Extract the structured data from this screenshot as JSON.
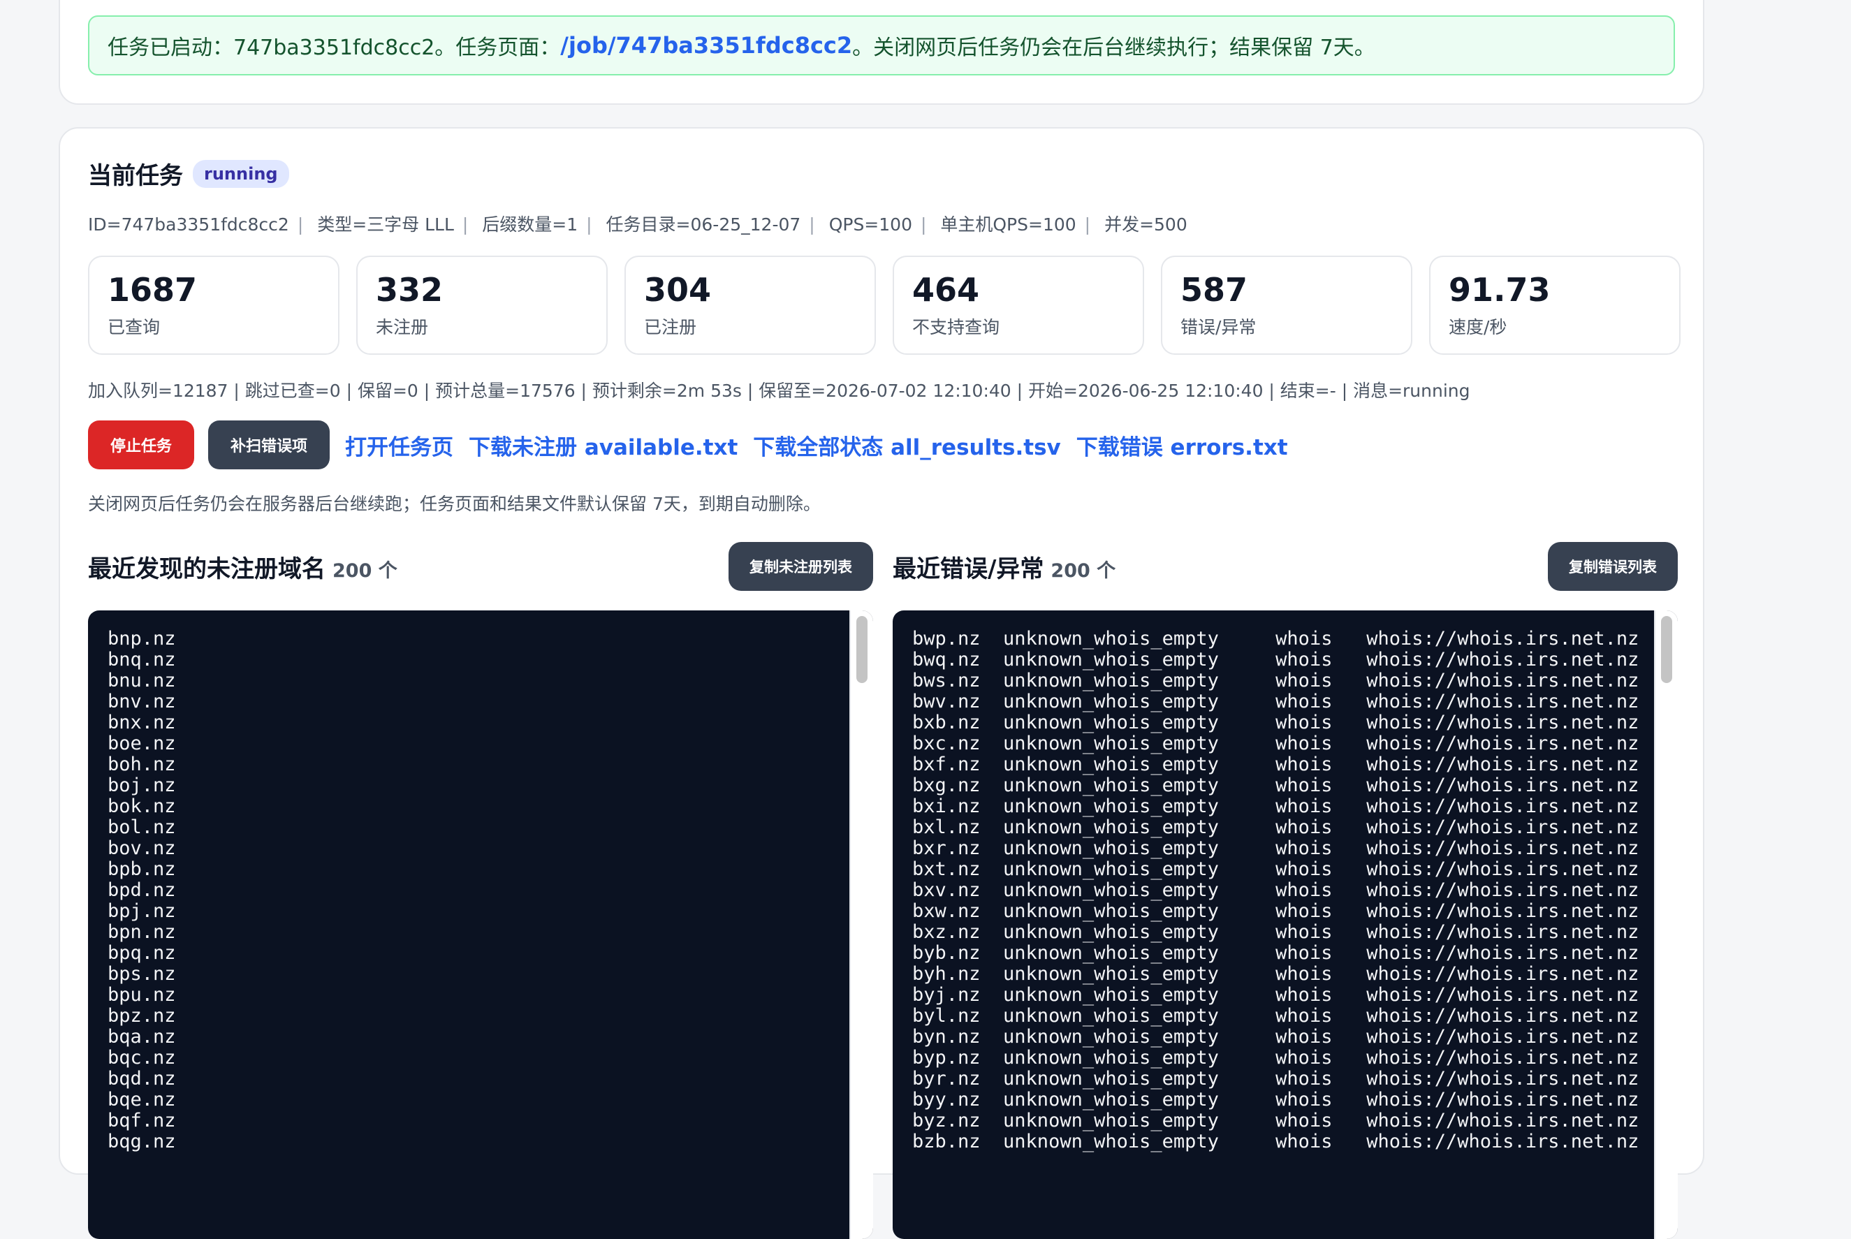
{
  "banner": {
    "prefix": "任务已启动：747ba3351fdc8cc2。任务页面：",
    "link": "/job/747ba3351fdc8cc2",
    "suffix": "。关闭网页后任务仍会在后台继续执行；结果保留 7天。"
  },
  "task": {
    "title": "当前任务",
    "status": "running",
    "meta": [
      "ID=747ba3351fdc8cc2",
      "类型=三字母 LLL",
      "后缀数量=1",
      "任务目录=06-25_12-07",
      "QPS=100",
      "单主机QPS=100",
      "并发=500"
    ],
    "meta_separator": "|"
  },
  "stats": [
    {
      "value": "1687",
      "label": "已查询"
    },
    {
      "value": "332",
      "label": "未注册"
    },
    {
      "value": "304",
      "label": "已注册"
    },
    {
      "value": "464",
      "label": "不支持查询"
    },
    {
      "value": "587",
      "label": "错误/异常"
    },
    {
      "value": "91.73",
      "label": "速度/秒"
    }
  ],
  "progress_text": "加入队列=12187 | 跳过已查=0 | 保留=0 | 预计总量=17576 | 预计剩余=2m 53s | 保留至=2026-07-02 12:10:40 | 开始=2026-06-25 12:10:40 | 结束=- | 消息=running",
  "actions": {
    "stop": "停止任务",
    "rescan": "补扫错误项",
    "open_page": "打开任务页",
    "dl_available": "下载未注册 available.txt",
    "dl_all": "下载全部状态 all_results.tsv",
    "dl_errors": "下载错误 errors.txt"
  },
  "note": "关闭网页后任务仍会在服务器后台继续跑；任务页面和结果文件默认保留 7天，到期自动删除。",
  "available_panel": {
    "title": "最近发现的未注册域名",
    "count": "200 个",
    "copy_label": "复制未注册列表",
    "lines": [
      "bnp.nz",
      "bnq.nz",
      "bnu.nz",
      "bnv.nz",
      "bnx.nz",
      "boe.nz",
      "boh.nz",
      "boj.nz",
      "bok.nz",
      "bol.nz",
      "bov.nz",
      "bpb.nz",
      "bpd.nz",
      "bpj.nz",
      "bpn.nz",
      "bpq.nz",
      "bps.nz",
      "bpu.nz",
      "bpz.nz",
      "bqa.nz",
      "bqc.nz",
      "bqd.nz",
      "bqe.nz",
      "bqf.nz",
      "bqg.nz"
    ]
  },
  "error_panel": {
    "title": "最近错误/异常",
    "count": "200 个",
    "copy_label": "复制错误列表",
    "lines": [
      "bwp.nz  unknown_whois_empty     whois   whois://whois.irs.net.nz",
      "bwq.nz  unknown_whois_empty     whois   whois://whois.irs.net.nz",
      "bws.nz  unknown_whois_empty     whois   whois://whois.irs.net.nz",
      "bwv.nz  unknown_whois_empty     whois   whois://whois.irs.net.nz",
      "bxb.nz  unknown_whois_empty     whois   whois://whois.irs.net.nz",
      "bxc.nz  unknown_whois_empty     whois   whois://whois.irs.net.nz",
      "bxf.nz  unknown_whois_empty     whois   whois://whois.irs.net.nz",
      "bxg.nz  unknown_whois_empty     whois   whois://whois.irs.net.nz",
      "bxi.nz  unknown_whois_empty     whois   whois://whois.irs.net.nz",
      "bxl.nz  unknown_whois_empty     whois   whois://whois.irs.net.nz",
      "bxr.nz  unknown_whois_empty     whois   whois://whois.irs.net.nz",
      "bxt.nz  unknown_whois_empty     whois   whois://whois.irs.net.nz",
      "bxv.nz  unknown_whois_empty     whois   whois://whois.irs.net.nz",
      "bxw.nz  unknown_whois_empty     whois   whois://whois.irs.net.nz",
      "bxz.nz  unknown_whois_empty     whois   whois://whois.irs.net.nz",
      "byb.nz  unknown_whois_empty     whois   whois://whois.irs.net.nz",
      "byh.nz  unknown_whois_empty     whois   whois://whois.irs.net.nz",
      "byj.nz  unknown_whois_empty     whois   whois://whois.irs.net.nz",
      "byl.nz  unknown_whois_empty     whois   whois://whois.irs.net.nz",
      "byn.nz  unknown_whois_empty     whois   whois://whois.irs.net.nz",
      "byp.nz  unknown_whois_empty     whois   whois://whois.irs.net.nz",
      "byr.nz  unknown_whois_empty     whois   whois://whois.irs.net.nz",
      "byy.nz  unknown_whois_empty     whois   whois://whois.irs.net.nz",
      "byz.nz  unknown_whois_empty     whois   whois://whois.irs.net.nz",
      "bzb.nz  unknown_whois_empty     whois   whois://whois.irs.net.nz"
    ]
  }
}
